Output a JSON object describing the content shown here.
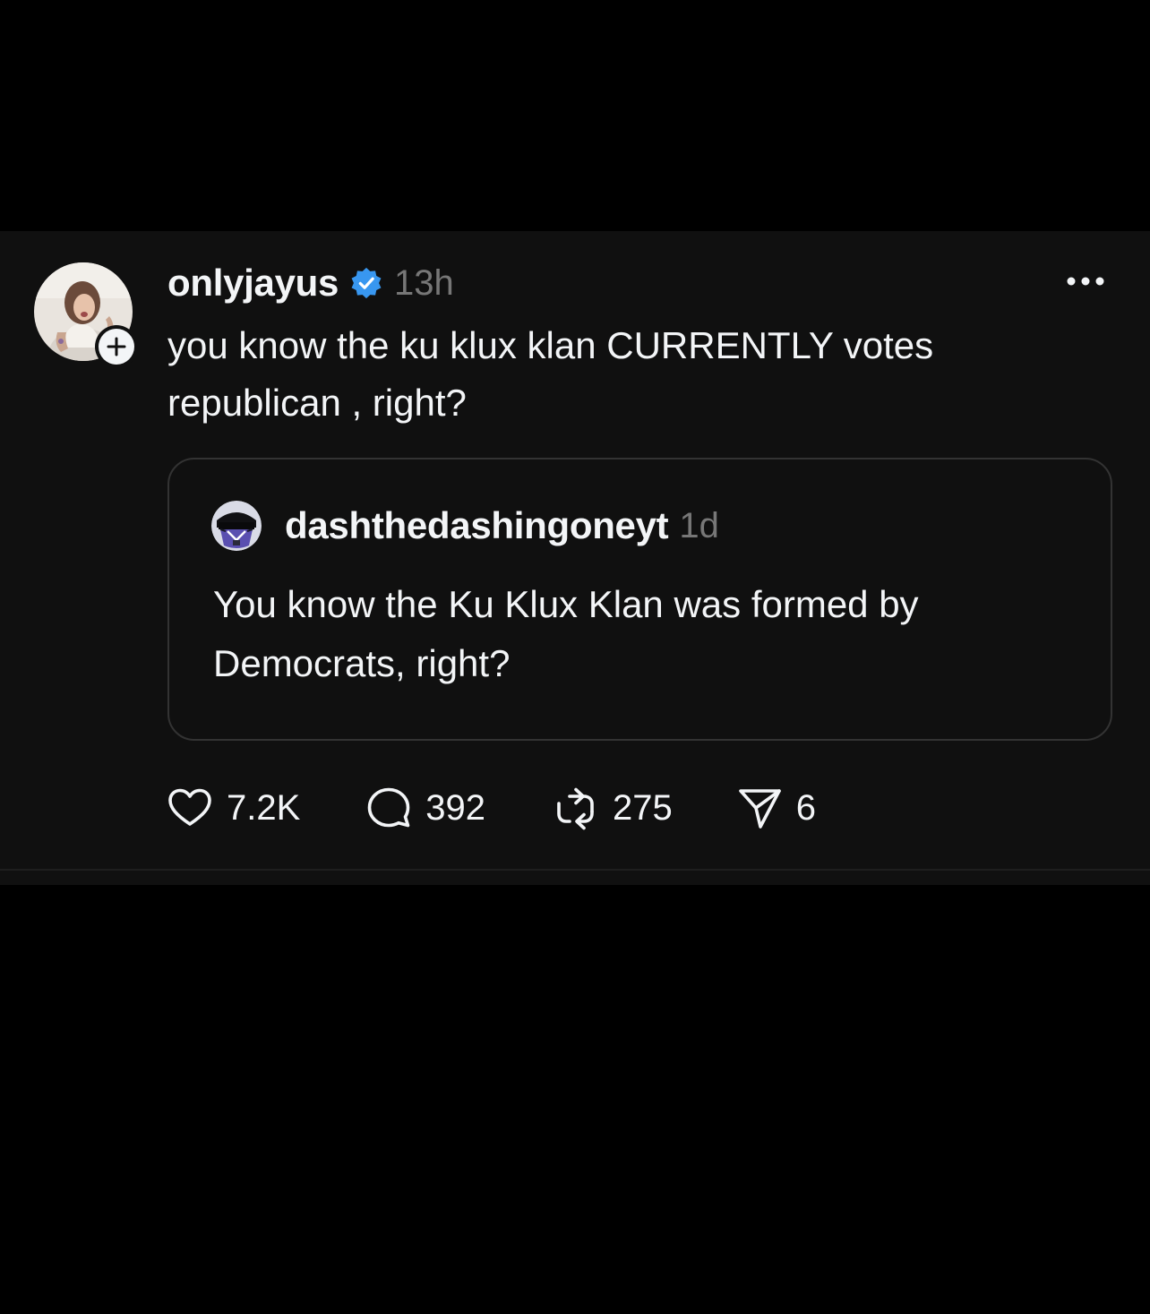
{
  "post": {
    "author": {
      "username": "onlyjayus",
      "timestamp": "13h",
      "avatar_icon": "profile-photo",
      "verified_icon": "verified-badge-icon",
      "verified_color": "#3897f0"
    },
    "text": "you know the ku klux klan CURRENTLY votes republican , right?",
    "quoted": {
      "username": "dashthedashingoneyt",
      "timestamp": "1d",
      "avatar_icon": "helmet-avatar",
      "text": "You know the Ku Klux Klan was formed by Democrats, right?"
    },
    "actions": {
      "likes": "7.2K",
      "comments": "392",
      "reposts": "275",
      "shares": "6"
    }
  },
  "colors": {
    "background": "#000000",
    "card": "#101010",
    "text": "#f3f5f7",
    "muted": "#777777",
    "border": "#333333"
  }
}
